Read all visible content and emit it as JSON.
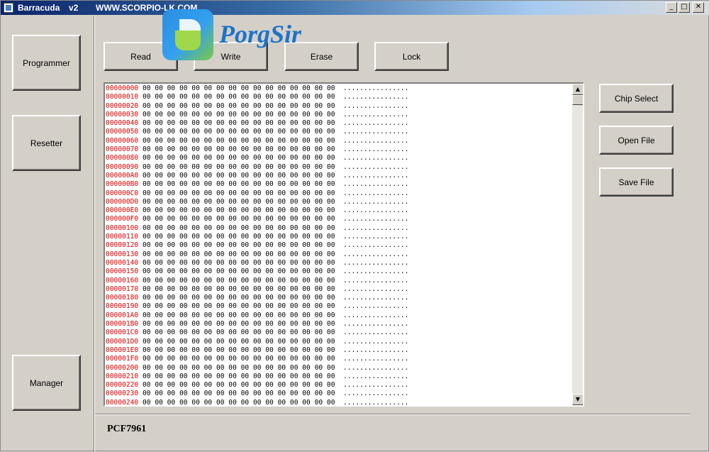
{
  "window": {
    "title": "Barracuda",
    "version": "v2",
    "url": "WWW.SCORPIO-LK.COM",
    "min_glyph": "_",
    "max_glyph": "□",
    "close_glyph": "✕"
  },
  "watermark": {
    "text": "PorgSir"
  },
  "sidebar": {
    "programmer": "Programmer",
    "resetter": "Resetter",
    "manager": "Manager"
  },
  "toolbar": {
    "read": "Read",
    "write": "Write",
    "erase": "Erase",
    "lock": "Lock"
  },
  "side_actions": {
    "chip_select": "Chip Select",
    "open_file": "Open File",
    "save_file": "Save File"
  },
  "scrollbar": {
    "up_glyph": "▲",
    "down_glyph": "▼"
  },
  "hex": {
    "bytes": "00 00 00 00 00 00 00 00 00 00 00 00 00 00 00 00",
    "ascii": "................",
    "addresses": [
      "00000000",
      "00000010",
      "00000020",
      "00000030",
      "00000040",
      "00000050",
      "00000060",
      "00000070",
      "00000080",
      "00000090",
      "000000A0",
      "000000B0",
      "000000C0",
      "000000D0",
      "000000E0",
      "000000F0",
      "00000100",
      "00000110",
      "00000120",
      "00000130",
      "00000140",
      "00000150",
      "00000160",
      "00000170",
      "00000180",
      "00000190",
      "000001A0",
      "000001B0",
      "000001C0",
      "000001D0",
      "000001E0",
      "000001F0",
      "00000200",
      "00000210",
      "00000220",
      "00000230",
      "00000240"
    ]
  },
  "status": {
    "chip": "PCF7961"
  }
}
